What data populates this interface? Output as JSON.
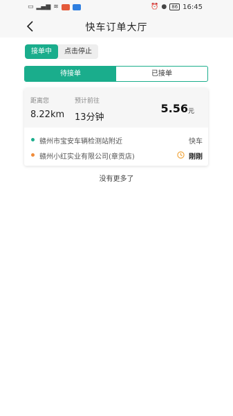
{
  "status_bar": {
    "time": "16:45",
    "battery": "86",
    "icons": [
      "sim-icon",
      "signal-icon",
      "wifi-icon",
      "app-notification-icon",
      "app-notification-icon",
      "alarm-icon",
      "location-icon",
      "battery-icon"
    ]
  },
  "nav": {
    "title": "快车订单大厅",
    "back_icon": "chevron-left-icon"
  },
  "toggle": {
    "active_label": "接单中",
    "inactive_label": "点击停止"
  },
  "tabs": [
    {
      "label": "待接单",
      "active": true
    },
    {
      "label": "已接单",
      "active": false
    }
  ],
  "order": {
    "distance_label": "距离您",
    "distance_value": "8.22km",
    "eta_label": "预计前往",
    "eta_value": "13分钟",
    "price": "5.56",
    "price_unit": "元",
    "pickup": "赣州市宝安车辆检测站附近",
    "dropoff": "赣州小红实业有限公司(章贡店)",
    "service_type": "快车",
    "time_tag": "刚刚"
  },
  "footer_text": "没有更多了",
  "colors": {
    "accent": "#1aad8c",
    "pickup_dot": "#1aad8c",
    "dropoff_dot": "#f08c3a",
    "clock": "#f0a030"
  }
}
